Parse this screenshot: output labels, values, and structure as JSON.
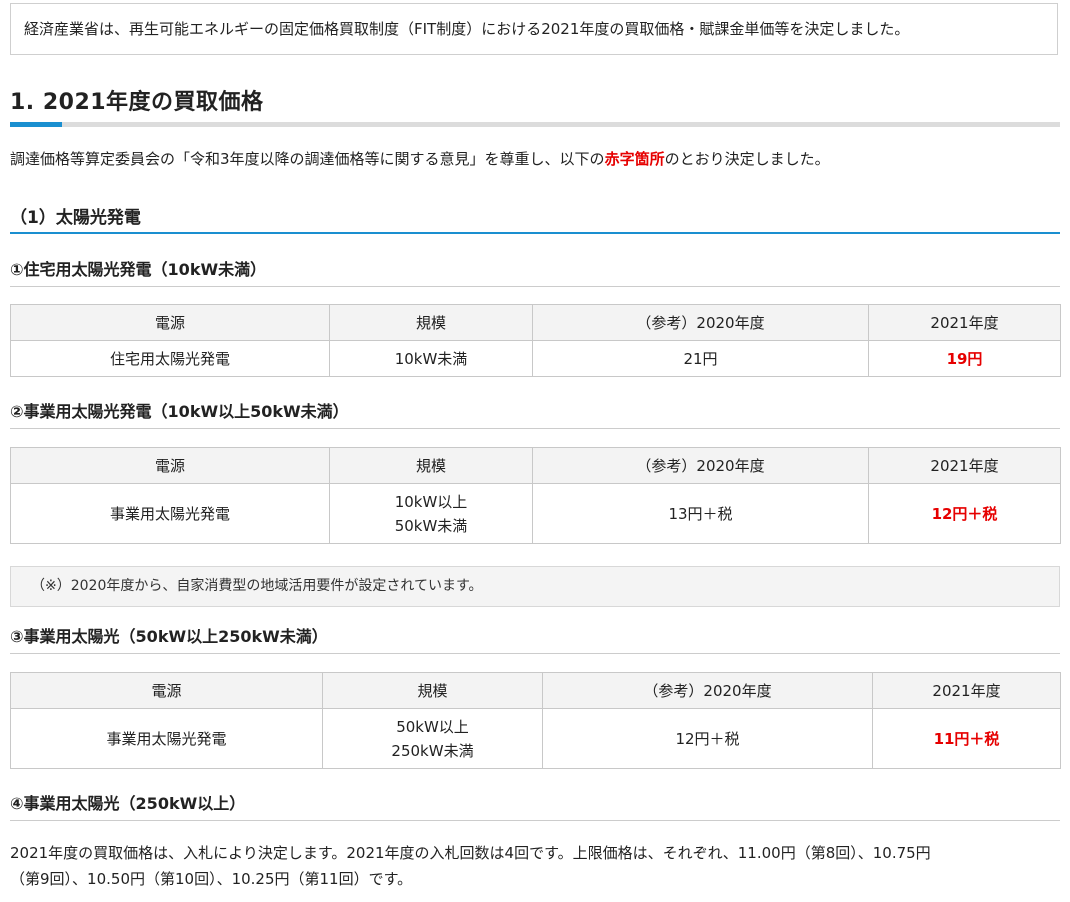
{
  "intro": "経済産業省は、再生可能エネルギーの固定価格買取制度（FIT制度）における2021年度の買取価格・賦課金単価等を決定しました。",
  "section1": {
    "title": "1.  2021年度の買取価格",
    "lead_before": "調達価格等算定委員会の「令和3年度以降の調達価格等に関する意見」を尊重し、以下の",
    "lead_red": "赤字箇所",
    "lead_after": "のとおり決定しました。"
  },
  "sub1": {
    "title": "（1）太陽光発電"
  },
  "table_headers": {
    "source": "電源",
    "scale": "規模",
    "ref2020": "（参考）2020年度",
    "fy2021": "2021年度"
  },
  "t1": {
    "title": "①住宅用太陽光発電（10kW未満）",
    "source": "住宅用太陽光発電",
    "scale": "10kW未満",
    "ref2020": "21円",
    "fy2021": "19円"
  },
  "t2": {
    "title": "②事業用太陽光発電（10kW以上50kW未満）",
    "source": "事業用太陽光発電",
    "scale_line1": "10kW以上",
    "scale_line2": "50kW未満",
    "ref2020": "13円＋税",
    "fy2021": "12円＋税"
  },
  "note": "（※）2020年度から、自家消費型の地域活用要件が設定されています。",
  "t3": {
    "title": "③事業用太陽光（50kW以上250kW未満）",
    "source": "事業用太陽光発電",
    "scale_line1": "50kW以上",
    "scale_line2": "250kW未満",
    "ref2020": "12円＋税",
    "fy2021": "11円＋税"
  },
  "t4": {
    "title": "④事業用太陽光（250kW以上）",
    "para_line1": "2021年度の買取価格は、入札により決定します。2021年度の入札回数は4回です。上限価格は、それぞれ、11.00円（第8回）、10.75円",
    "para_line2": "（第9回）、10.50円（第10回）、10.25円（第11回）です。"
  },
  "colors": {
    "accent": "#1a8fd0",
    "highlight_red": "#e60000"
  }
}
